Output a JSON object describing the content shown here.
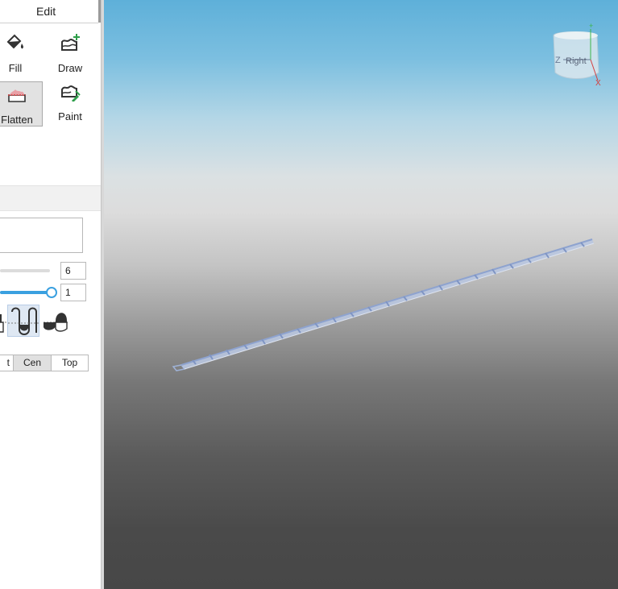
{
  "panel": {
    "tab_label": "Edit",
    "tools": [
      {
        "label": "Fill",
        "icon": "paint-bucket-icon",
        "selected": false
      },
      {
        "label": "Draw",
        "icon": "terrain-add-icon",
        "selected": false
      },
      {
        "label": "Flatten",
        "icon": "flatten-icon",
        "selected": true
      },
      {
        "label": "Paint",
        "icon": "terrain-paint-icon",
        "selected": false
      }
    ],
    "size_value": "6",
    "strength_value": "1",
    "strength_level": 1.0,
    "pivot_options": [
      "Bot",
      "Cen",
      "Top"
    ],
    "pivot_visible": [
      "t",
      "Cen",
      "Top"
    ],
    "pivot_selected": "Cen"
  },
  "viewport": {
    "view_cube_label": "Right",
    "axis_z_label": "Z",
    "axis_x_label": "X",
    "colors": {
      "sky_top": "#5eb0d9",
      "horizon": "#dcdcdc",
      "ground": "#474747",
      "part": "#9fb2d6"
    }
  }
}
